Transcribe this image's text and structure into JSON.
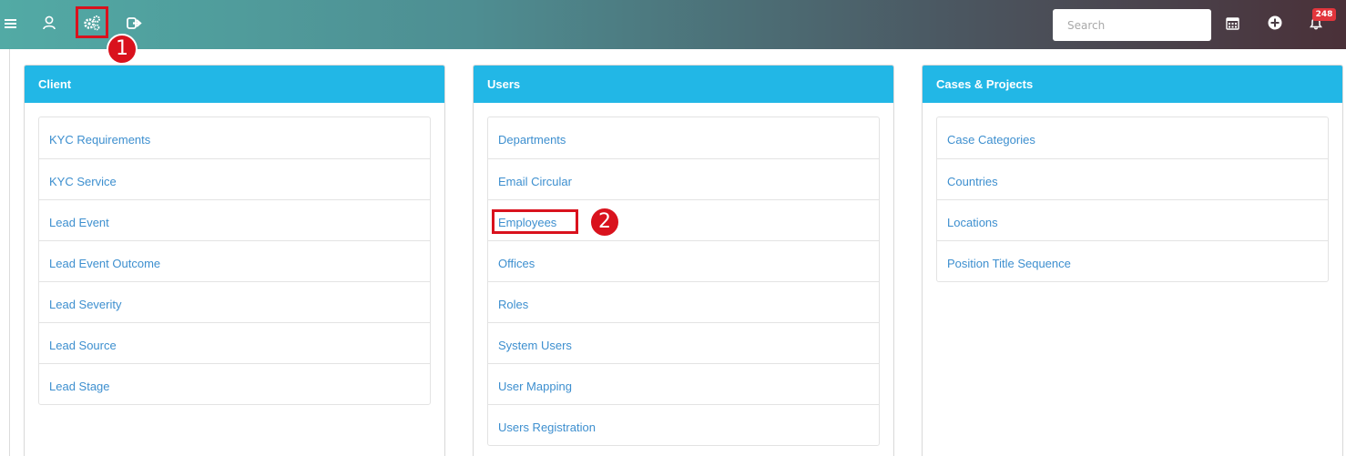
{
  "topbar": {
    "search": {
      "placeholder": "Search",
      "value": ""
    },
    "notifications": {
      "count": "248"
    },
    "icons": [
      "menu-icon",
      "user-icon",
      "cogs-icon",
      "sign-out-icon",
      "calendar-icon",
      "plus-circle-icon",
      "bell-icon"
    ]
  },
  "annotations": {
    "marker1": "1",
    "marker2": "2",
    "highlight_color": "#d9121d"
  },
  "colors": {
    "panel_header": "#22b7e6",
    "link": "#3d8fcf"
  },
  "panels": {
    "client": {
      "title": "Client",
      "items": [
        "KYC Requirements",
        "KYC Service",
        "Lead Event",
        "Lead Event Outcome",
        "Lead Severity",
        "Lead Source",
        "Lead Stage"
      ]
    },
    "users": {
      "title": "Users",
      "items": [
        "Departments",
        "Email Circular",
        "Employees",
        "Offices",
        "Roles",
        "System Users",
        "User Mapping",
        "Users Registration"
      ]
    },
    "cases": {
      "title": "Cases & Projects",
      "items": [
        "Case Categories",
        "Countries",
        "Locations",
        "Position Title Sequence"
      ]
    }
  }
}
